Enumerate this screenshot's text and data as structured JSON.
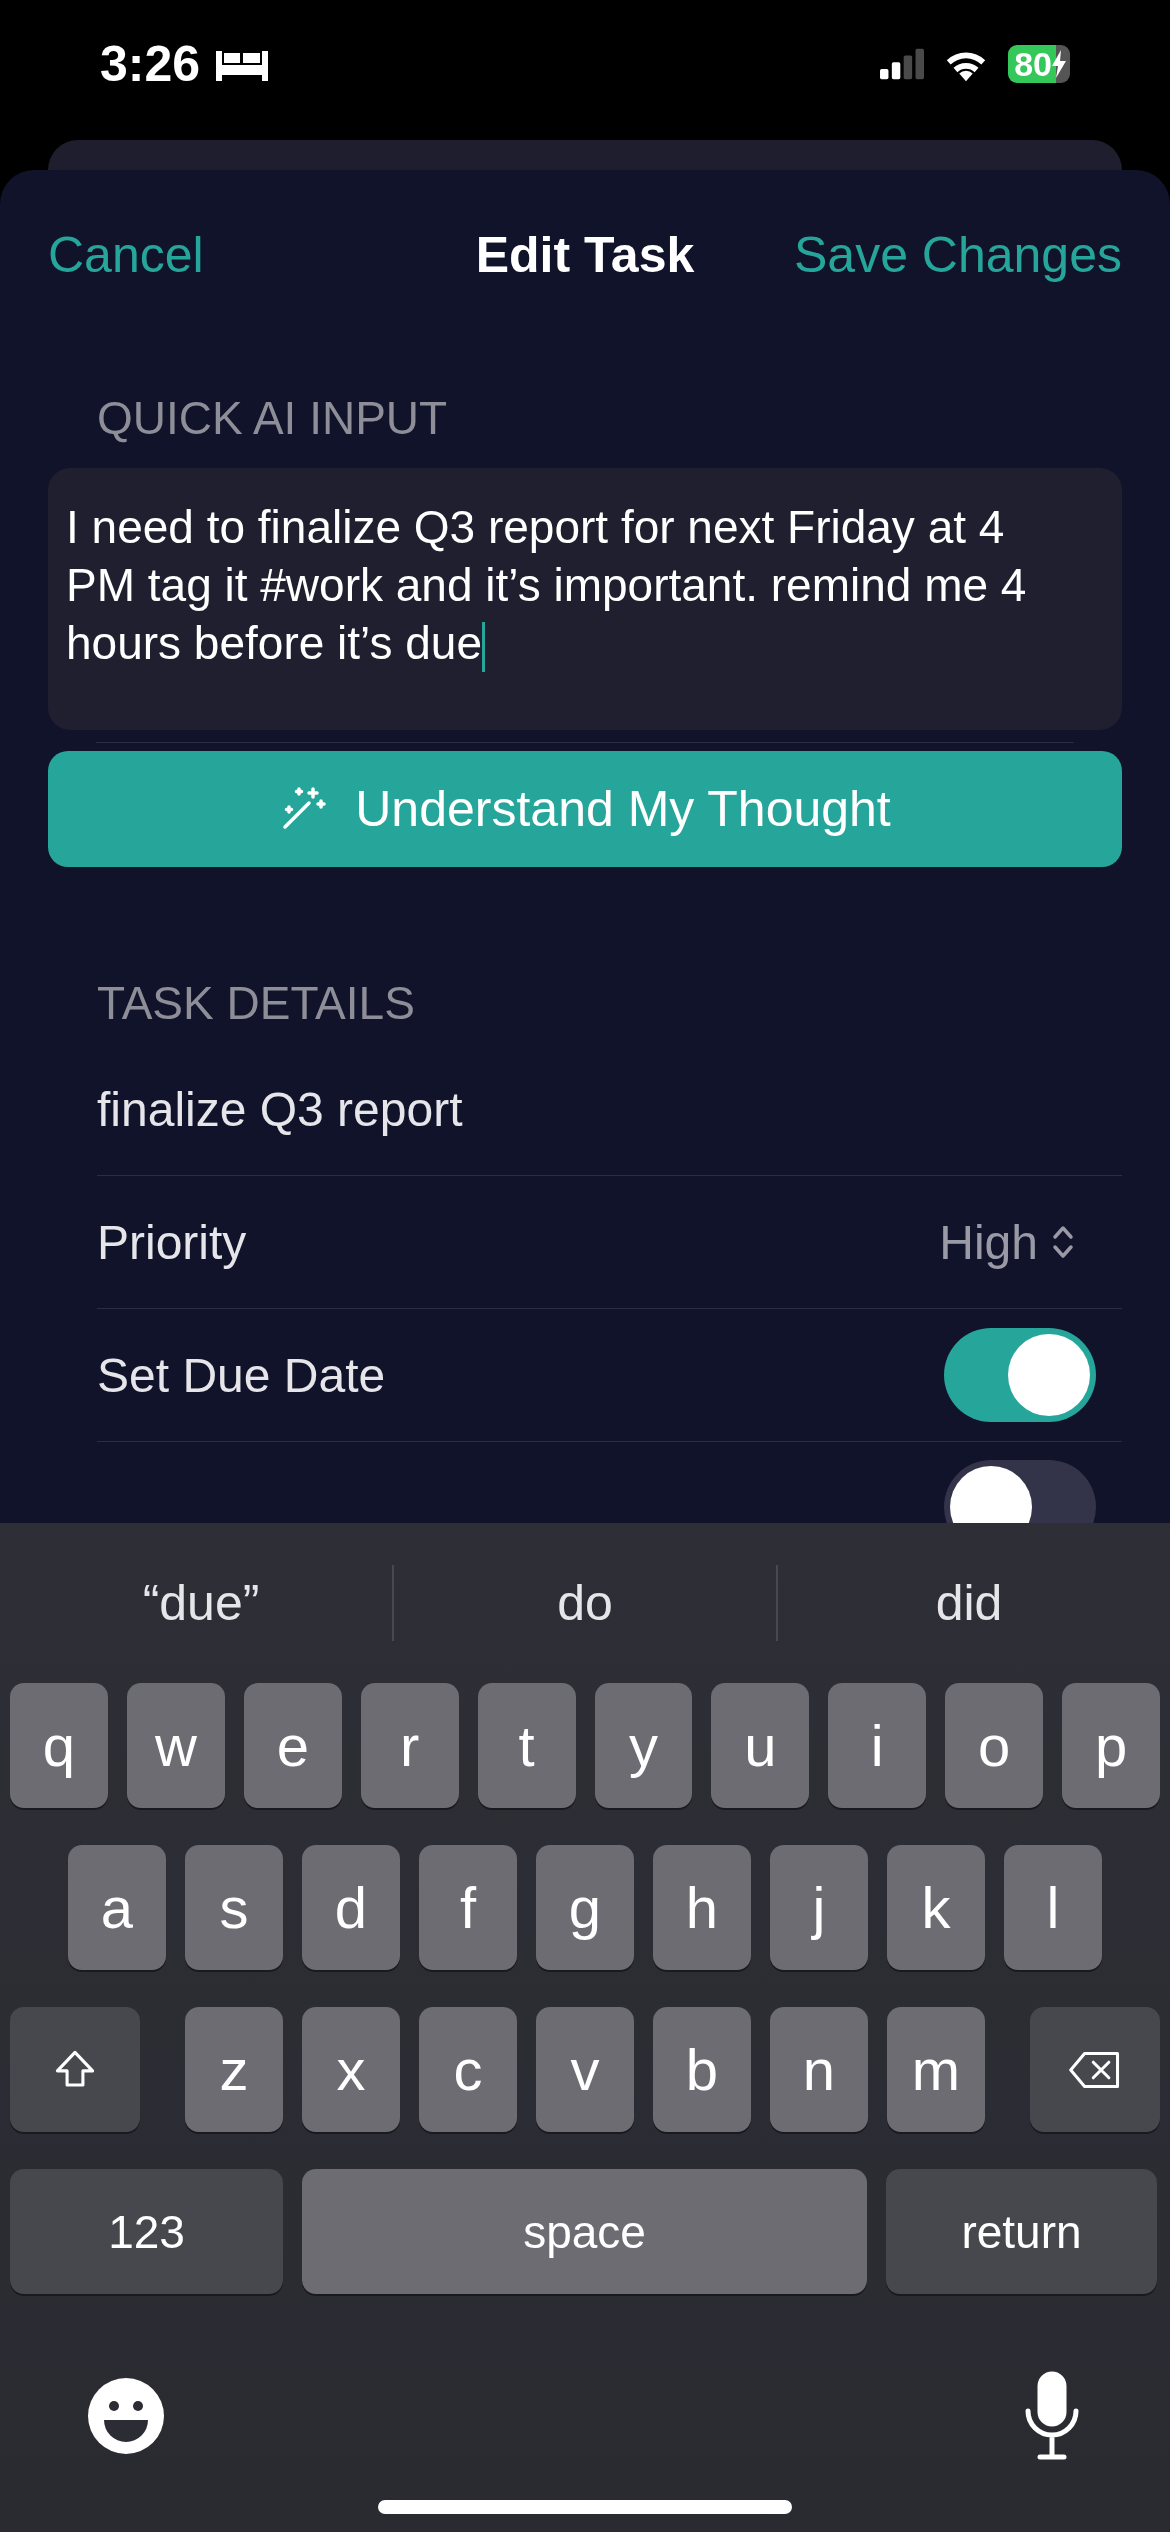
{
  "status_bar": {
    "time": "3:26",
    "battery": "80"
  },
  "header": {
    "cancel": "Cancel",
    "title": "Edit Task",
    "save": "Save Changes"
  },
  "quick_input": {
    "label": "QUICK AI INPUT",
    "value": "I need to finalize Q3 report for next Friday at 4 PM tag it #work and it’s important. remind me 4 hours before it’s due",
    "button": "Understand My Thought"
  },
  "task_details": {
    "label": "TASK DETAILS",
    "rows": [
      {
        "kind": "text",
        "label": "finalize Q3 report"
      },
      {
        "kind": "picker",
        "label": "Priority",
        "value": "High"
      },
      {
        "kind": "toggle",
        "label": "Set Due Date",
        "on": true
      },
      {
        "kind": "toggle",
        "on": false
      }
    ]
  },
  "keyboard": {
    "suggestions": [
      "“due”",
      "do",
      "did"
    ],
    "key_rows": [
      {
        "keys": [
          {
            "kind": "letter",
            "label": "q"
          },
          {
            "kind": "letter",
            "label": "w"
          },
          {
            "kind": "letter",
            "label": "e"
          },
          {
            "kind": "letter",
            "label": "r"
          },
          {
            "kind": "letter",
            "label": "t"
          },
          {
            "kind": "letter",
            "label": "y"
          },
          {
            "kind": "letter",
            "label": "u"
          },
          {
            "kind": "letter",
            "label": "i"
          },
          {
            "kind": "letter",
            "label": "o"
          },
          {
            "kind": "letter",
            "label": "p"
          }
        ]
      },
      {
        "keys": [
          {
            "kind": "letter",
            "label": "a"
          },
          {
            "kind": "letter",
            "label": "s"
          },
          {
            "kind": "letter",
            "label": "d"
          },
          {
            "kind": "letter",
            "label": "f"
          },
          {
            "kind": "letter",
            "label": "g"
          },
          {
            "kind": "letter",
            "label": "h"
          },
          {
            "kind": "letter",
            "label": "j"
          },
          {
            "kind": "letter",
            "label": "k"
          },
          {
            "kind": "letter",
            "label": "l"
          }
        ]
      },
      {
        "keys": [
          {
            "kind": "shift"
          },
          {
            "kind": "letter",
            "label": "z"
          },
          {
            "kind": "letter",
            "label": "x"
          },
          {
            "kind": "letter",
            "label": "c"
          },
          {
            "kind": "letter",
            "label": "v"
          },
          {
            "kind": "letter",
            "label": "b"
          },
          {
            "kind": "letter",
            "label": "n"
          },
          {
            "kind": "letter",
            "label": "m"
          },
          {
            "kind": "delete"
          }
        ]
      },
      {
        "keys": [
          {
            "kind": "numbers",
            "label": "123"
          },
          {
            "kind": "space",
            "label": "space"
          },
          {
            "kind": "return",
            "label": "return"
          }
        ]
      }
    ]
  }
}
